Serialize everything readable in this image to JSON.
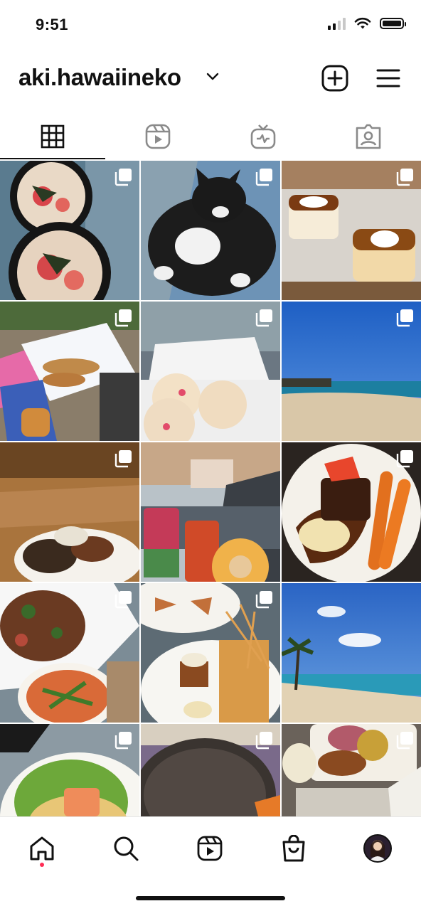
{
  "status": {
    "time": "9:51"
  },
  "header": {
    "username": "aki.hawaiineko"
  },
  "icons": {
    "chevron": "chevron-down-icon",
    "new_post": "plus-square-icon",
    "menu": "hamburger-menu-icon",
    "tabs": [
      "grid-icon",
      "reels-icon",
      "igtv-icon",
      "tagged-icon"
    ],
    "nav": [
      "home-icon",
      "search-icon",
      "reels-icon",
      "shop-icon",
      "profile-avatar"
    ]
  },
  "posts": [
    {
      "desc": "poke bowls",
      "multiple": true
    },
    {
      "desc": "black and white cat",
      "multiple": true
    },
    {
      "desc": "flan desserts",
      "multiple": true
    },
    {
      "desc": "malasadas in bags",
      "multiple": true
    },
    {
      "desc": "buns in container",
      "multiple": true
    },
    {
      "desc": "beach and ocean",
      "multiple": true
    },
    {
      "desc": "plate lunch on table",
      "multiple": true
    },
    {
      "desc": "drinks and donut",
      "multiple": false
    },
    {
      "desc": "braised beef with carrots",
      "multiple": true
    },
    {
      "desc": "stir fry and noodle bowl",
      "multiple": true
    },
    {
      "desc": "appetizers and dessert",
      "multiple": true
    },
    {
      "desc": "palm tree beach",
      "multiple": false
    },
    {
      "desc": "pasta salad with salmon",
      "multiple": true
    },
    {
      "desc": "black bean pancake",
      "multiple": true
    },
    {
      "desc": "plate lunch and burger",
      "multiple": true
    }
  ],
  "colors": {
    "notification": "#ff2d55",
    "text": "#111111"
  }
}
